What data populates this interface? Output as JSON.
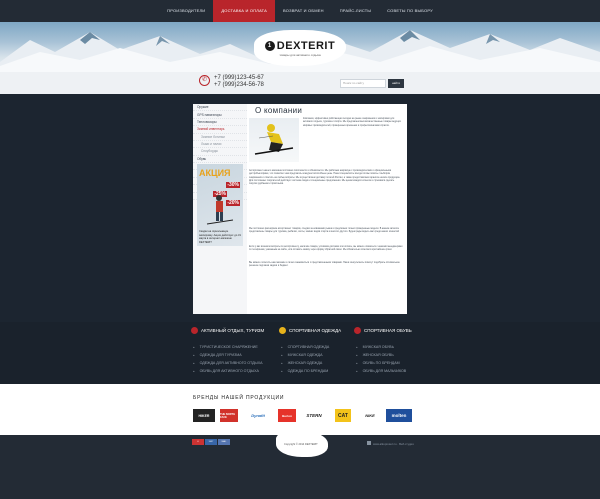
{
  "nav": {
    "items": [
      {
        "label": "Производители",
        "active": false
      },
      {
        "label": "Доставка и оплата",
        "active": true
      },
      {
        "label": "Возврат и обмен",
        "active": false
      },
      {
        "label": "Прайс-листы",
        "active": false
      },
      {
        "label": "Советы по выбору",
        "active": false
      }
    ]
  },
  "header": {
    "brand": "DEXTERIT",
    "logo_mark": "1",
    "tagline": "товары для активного отдыха"
  },
  "contact": {
    "phone1": "+7 (999)123-45-67",
    "phone2": "+7 (999)234-56-78",
    "search_placeholder": "Поиск по сайту",
    "search_button": "найти"
  },
  "sidebar": {
    "items": [
      {
        "label": "Оружие",
        "type": "item"
      },
      {
        "label": "GPS навигаторы",
        "type": "item"
      },
      {
        "label": "Тепловизоры",
        "type": "item"
      },
      {
        "label": "Зимний инвентарь",
        "type": "active"
      },
      {
        "label": "Зимние ботинки",
        "type": "sub"
      },
      {
        "label": "Лыжи и палки",
        "type": "sub"
      },
      {
        "label": "Сноуборды",
        "type": "sub"
      },
      {
        "label": "Обувь",
        "type": "item"
      },
      {
        "label": "Бронежилеты",
        "type": "item"
      },
      {
        "label": "Шлемы",
        "type": "item"
      },
      {
        "label": "Ножи",
        "type": "item"
      },
      {
        "label": "Перчатки и варежки",
        "type": "item"
      },
      {
        "label": "Сумки и чехлы",
        "type": "item"
      }
    ],
    "promo": {
      "title": "АКЦИЯ",
      "discount1": "-30%",
      "discount2": "-25%",
      "discount3": "-20%",
      "caption": "Скидки на горнолыжную экипировку. Акция действует до 31 марта в интернет-магазине DEXTERIT"
    }
  },
  "main": {
    "title": "О компании",
    "intro": "Компания, эффективно работающая сегодня на рынке снаряжения и экипировки для активного отдыха, туризма и спорта. Мы предлагаем высококачественные товары ведущих мировых производителей, проверенных временем и профессионалами отрасли.",
    "paragraph1": "Ассортимент нашего магазина постоянно пополняется и обновляется. Мы работаем напрямую с производителями и официальными дистрибьюторами, что позволяет нам предлагать конкурентоспособные цены. Наши специалисты всегда готовы помочь с выбором снаряжения и ответить на любые вопросы. Мы осуществляем доставку по всей России, а также предоставляем гарантию на всю продукцию. Для постоянных покупателей действует система скидок и специальные предложения. Мы ценим каждого клиента и стремимся сделать покупки удобными и приятными.",
    "paragraph2": "Мы постоянно расширяем ассортимент товаров, следим за новинками рынка и предлагаем только проверенные модели. В нашем каталоге представлены товары для туризма, рыбалки, охоты, зимних видов спорта и многого другого. Будем рады видеть вас среди наших клиентов!",
    "paragraph3": "Если у вас возникли вопросы по ассортименту, наличию товара, условиям доставки или оплаты, вы можете связаться с нашими менеджерами по телефонам, указанным на сайте, или оставить заявку через форму обратной связи. Мы обязательно ответим в кратчайшие сроки.",
    "paragraph4": "Вы можете посетить наш магазин и лично ознакомиться с представленными товарами. Наши консультанты помогут подобрать оптимальное решение под ваши задачи и бюджет."
  },
  "features": {
    "columns": [
      {
        "heading": "Активный отдых, туризм",
        "color": "#b9252b",
        "links": [
          "Туристическое снаряжение",
          "Одежда для туризма",
          "Одежда для активного отдыха",
          "Обувь для активного отдыха"
        ]
      },
      {
        "heading": "Спортивная одежда",
        "color": "#e7b21b",
        "links": [
          "Спортивная одежда",
          "Мужская одежда",
          "Женская одежда",
          "Одежда по брендам"
        ]
      },
      {
        "heading": "Спортивная обувь",
        "color": "#b9252b",
        "links": [
          "Мужская обувь",
          "Женская обувь",
          "Обувь по брендам",
          "Обувь для мальчиков"
        ]
      }
    ]
  },
  "brands": {
    "title": "Бренды нашей продукции",
    "logos": [
      "HIKER",
      "THE NORTH FACE",
      "Dynafit",
      "Burton",
      "STERN",
      "CAT",
      "NIKE",
      "molten"
    ]
  },
  "footer": {
    "copyright": "Copyright © 2014 DEXTERIT",
    "counter": [
      "LI",
      "9437",
      "MAIL"
    ],
    "developer": "www.alkuprotect.ru · Веб-студия"
  }
}
